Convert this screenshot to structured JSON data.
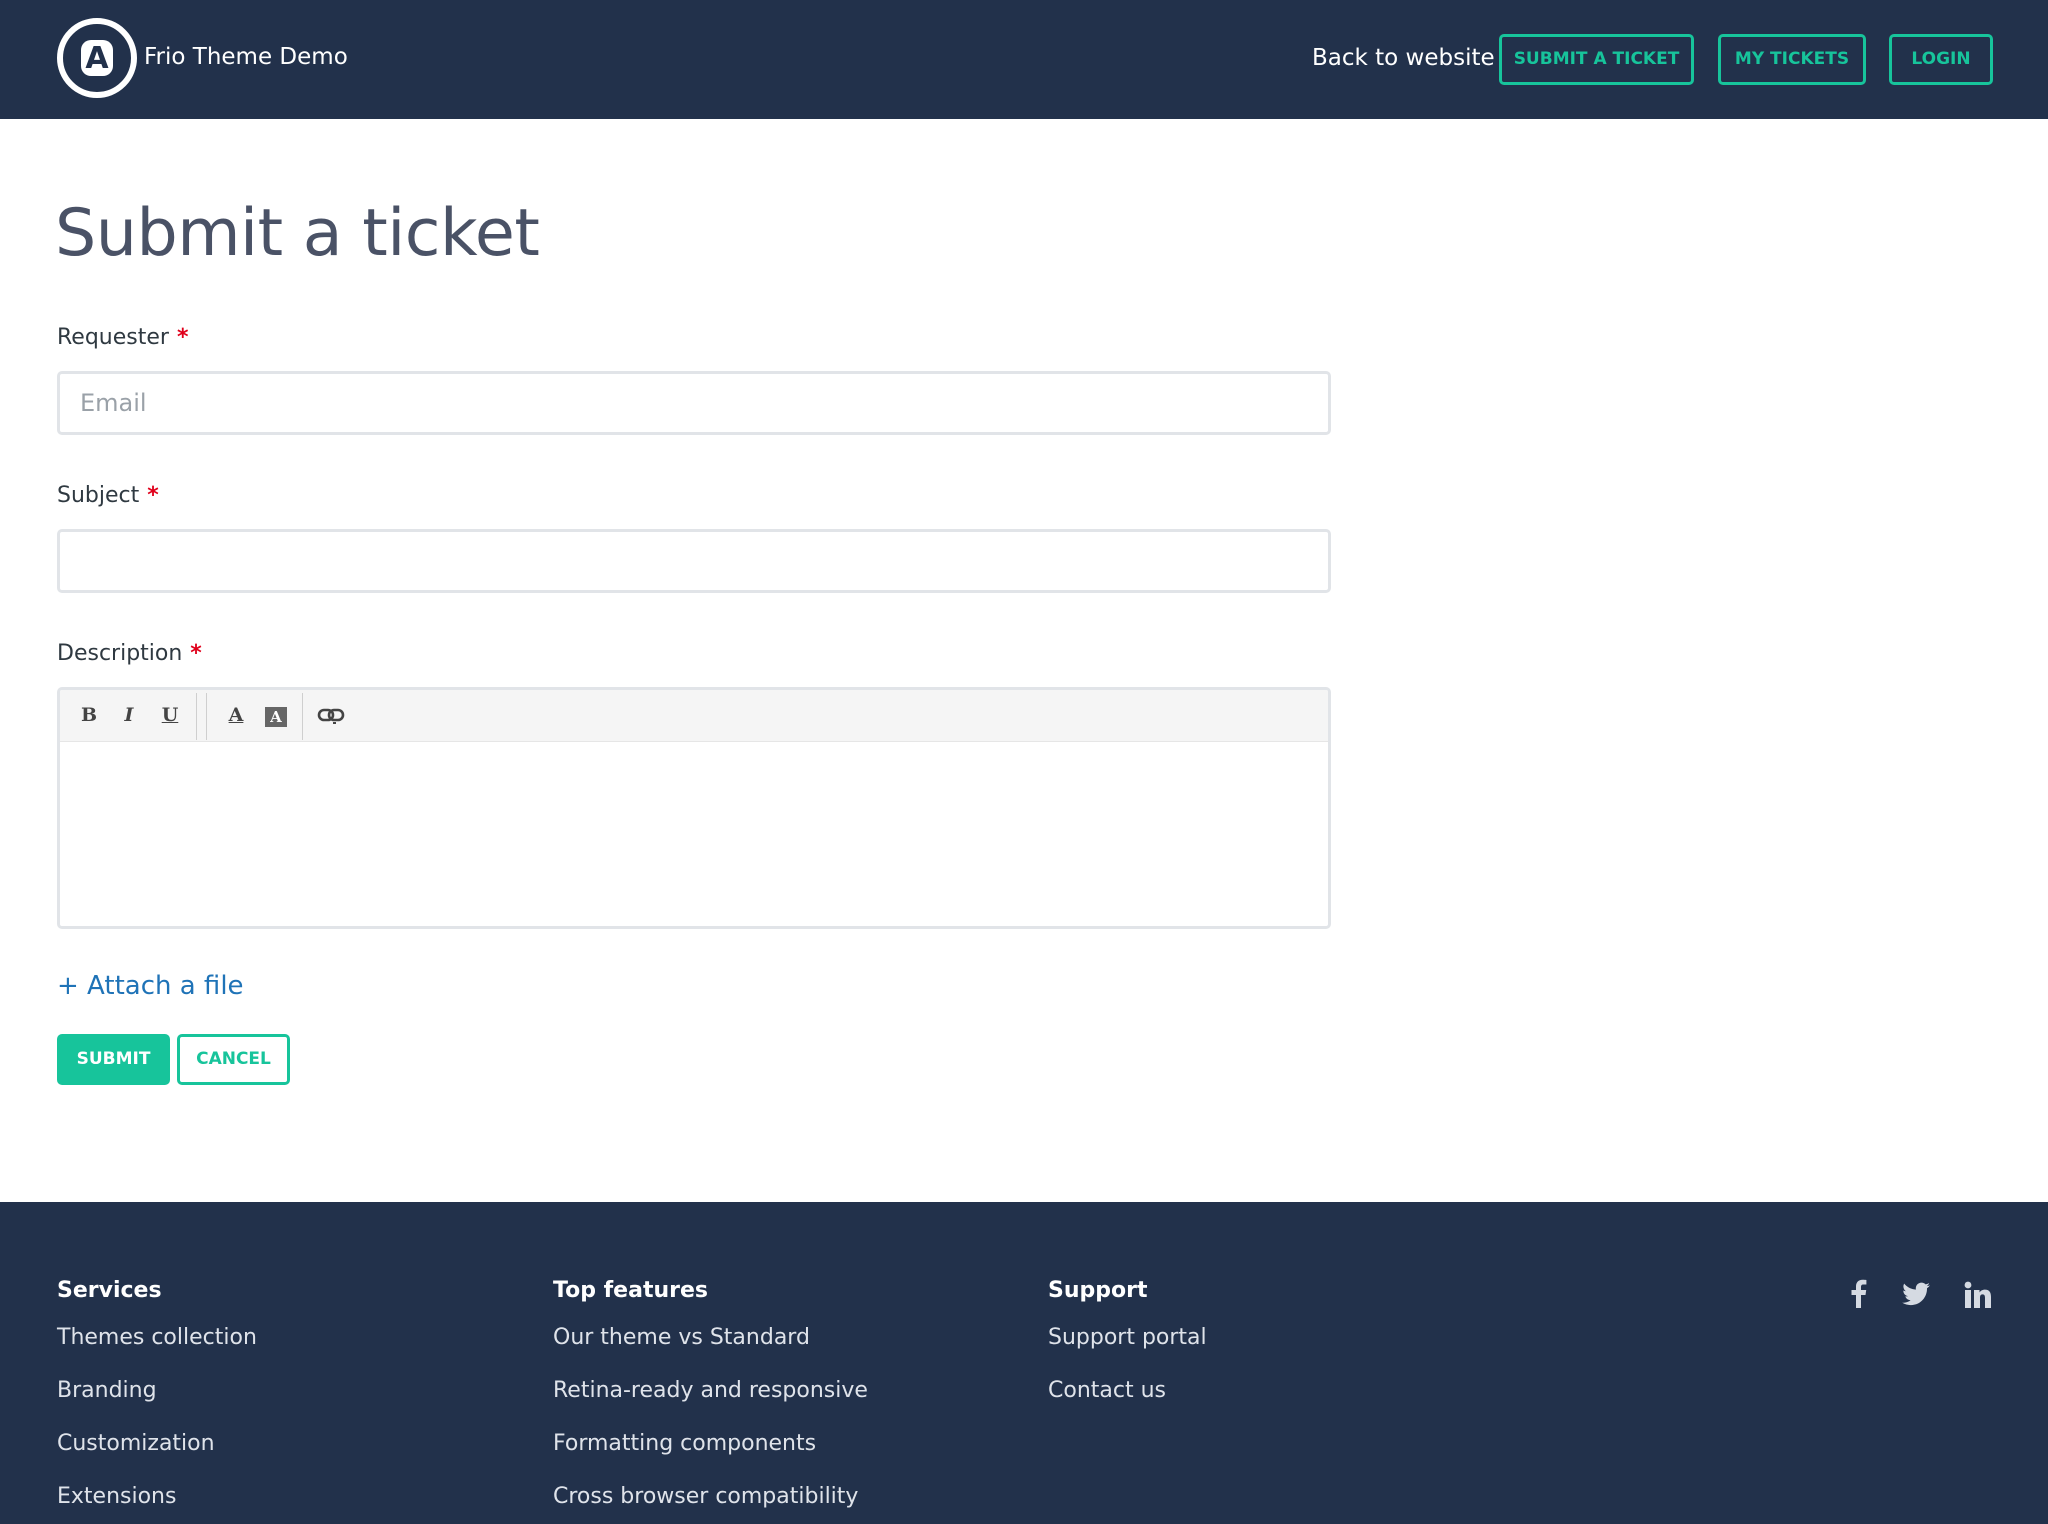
{
  "header": {
    "logo_letter": "A",
    "brand": "Frio Theme Demo",
    "back_link": "Back to website",
    "submit_ticket": "SUBMIT A TICKET",
    "my_tickets": "MY TICKETS",
    "login": "LOGIN"
  },
  "main": {
    "title": "Submit a ticket",
    "requester": {
      "label": "Requester",
      "required": "*",
      "placeholder": "Email",
      "value": ""
    },
    "subject": {
      "label": "Subject",
      "required": "*",
      "value": ""
    },
    "description": {
      "label": "Description",
      "required": "*",
      "toolbar": {
        "bold": "B",
        "italic": "I",
        "underline": "U",
        "font_color": "A",
        "background_color": "A"
      }
    },
    "attach": "+ Attach a file",
    "submit": "SUBMIT",
    "cancel": "CANCEL"
  },
  "footer": {
    "columns": [
      {
        "title": "Services",
        "links": [
          "Themes collection",
          "Branding",
          "Customization",
          "Extensions"
        ]
      },
      {
        "title": "Top features",
        "links": [
          "Our theme vs Standard",
          "Retina-ready and responsive",
          "Formatting components",
          "Cross browser compatibility"
        ]
      },
      {
        "title": "Support",
        "links": [
          "Support portal",
          "Contact us"
        ]
      }
    ],
    "social_icons": [
      "facebook-icon",
      "twitter-icon",
      "linkedin-icon"
    ]
  },
  "colors": {
    "header_bg": "#22314b",
    "accent": "#17c49b",
    "link": "#1f73b7",
    "required": "#e0001b"
  }
}
